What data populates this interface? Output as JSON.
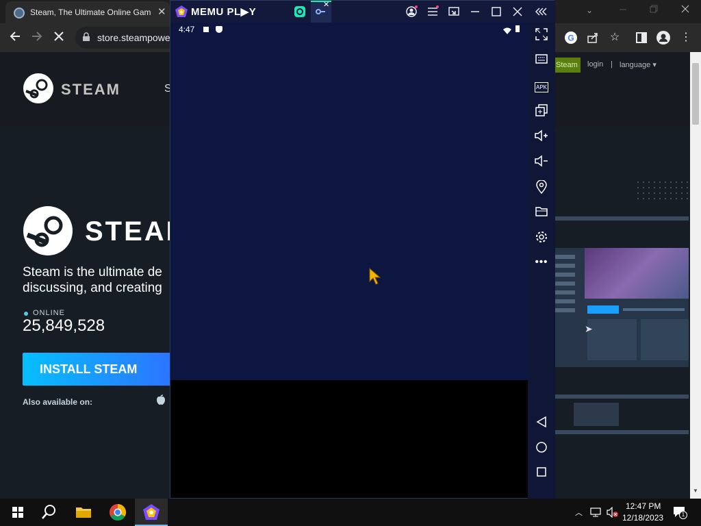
{
  "chrome": {
    "tab_title": "Steam, The Ultimate Online Gam",
    "tab_close": "✕",
    "url": "store.steampowe",
    "window_controls": [
      "minimize",
      "restore",
      "close"
    ]
  },
  "steam": {
    "logo_text": "STEAM",
    "nav_partial": "S",
    "topbar_install": "Steam",
    "login": "login",
    "separator": "|",
    "language": "language",
    "big_logo_text": "STEAM",
    "description": "Steam is the ultimate de discussing, and creating",
    "online_label": "ONLINE",
    "online_count": "25,849,528",
    "install_button": "INSTALL STEAM",
    "also_available": "Also available on:"
  },
  "memu": {
    "logo": "MEMU PL▶Y",
    "android_time": "4:47",
    "sidebar_icons": [
      "fullscreen-icon",
      "keyboard-icon",
      "apk-icon",
      "multi-instance-icon",
      "volume-up-icon",
      "volume-down-icon",
      "location-icon",
      "folder-icon",
      "settings-icon",
      "more-icon",
      "back-icon",
      "home-icon",
      "recents-icon"
    ],
    "apk_label": "APK"
  },
  "taskbar": {
    "time": "12:47 PM",
    "date": "12/18/2023",
    "notification_count": "1"
  },
  "colors": {
    "steam_bg": "#171d25",
    "install_gradient_start": "#06bfff",
    "install_gradient_end": "#2d73ff",
    "memu_screen": "#0c1640",
    "online_dot": "#57cbde"
  }
}
